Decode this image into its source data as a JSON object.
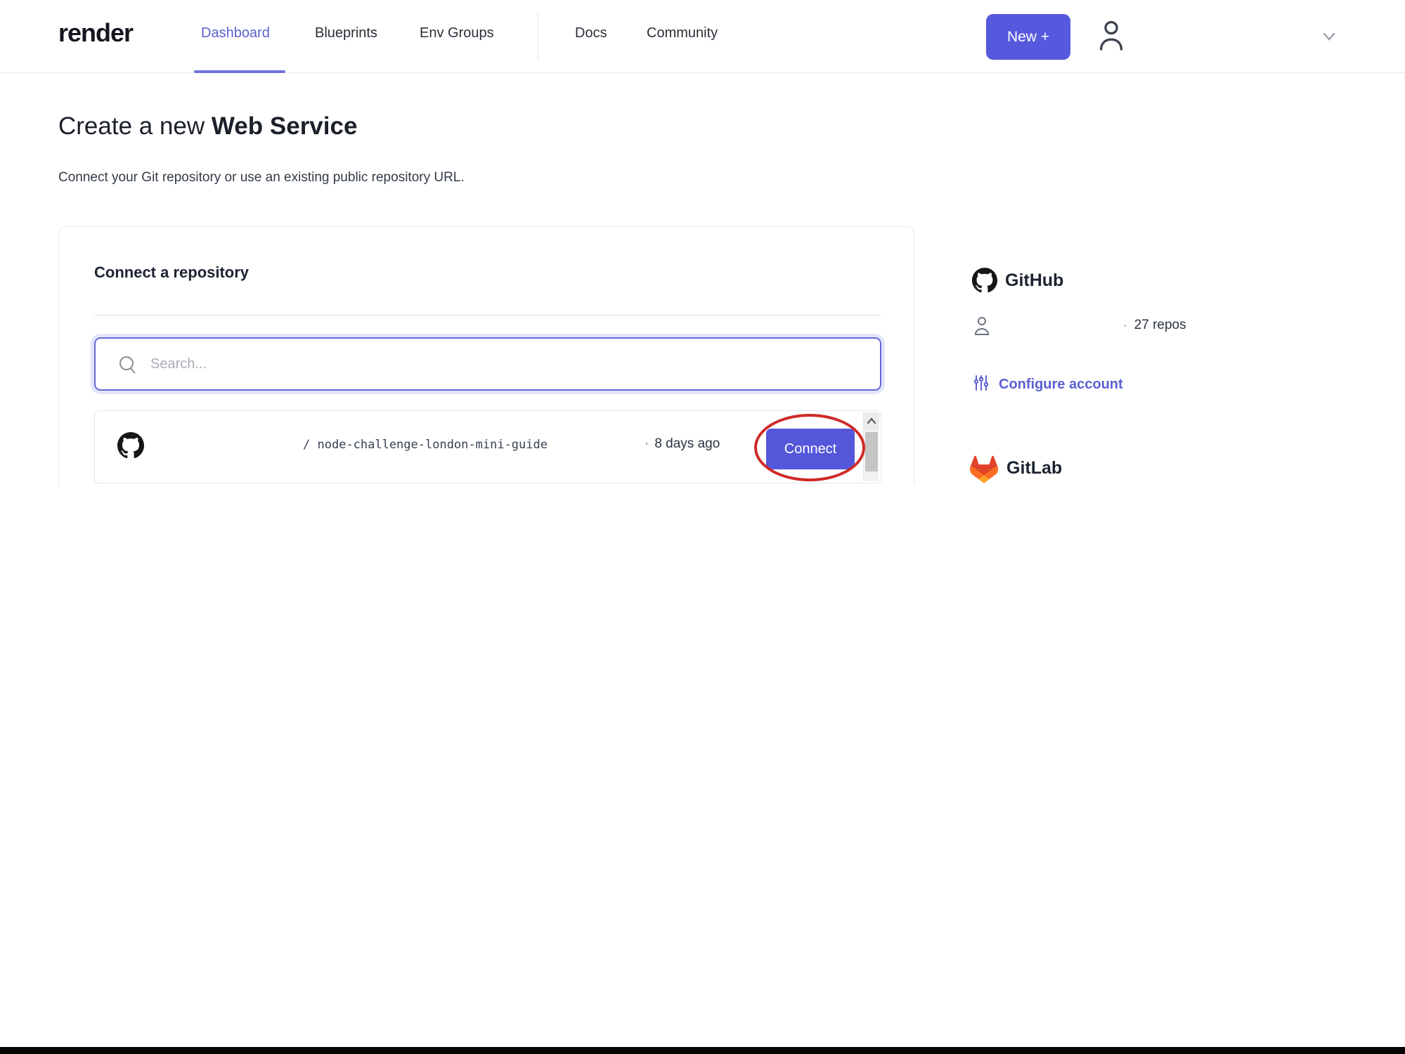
{
  "nav": {
    "logo": "render",
    "items": [
      {
        "label": "Dashboard"
      },
      {
        "label": "Blueprints"
      },
      {
        "label": "Env Groups"
      },
      {
        "label": "Docs"
      },
      {
        "label": "Community"
      }
    ],
    "new_button_label": "New +"
  },
  "page": {
    "title_regular": "Create a new ",
    "title_bold": "Web Service",
    "subtitle": "Connect your Git repository or use an existing public repository URL."
  },
  "card": {
    "heading": "Connect a repository",
    "search_placeholder": "Search...",
    "repo": {
      "owner": "",
      "path": "/ node-challenge-london-mini-guide",
      "bullet": "·",
      "updated": "8 days ago",
      "connect_label": "Connect"
    }
  },
  "sidebar": {
    "github": {
      "title": "GitHub",
      "bullet": "·",
      "repos_count": "27 repos",
      "configure_label": "Configure account"
    },
    "gitlab": {
      "title": "GitLab"
    }
  },
  "colors": {
    "accent": "#5659dd",
    "active_nav": "#5a5fd0",
    "annotation_red": "#cf2a27",
    "gitlab_orange": "#e2432a",
    "github_black": "#171515"
  }
}
